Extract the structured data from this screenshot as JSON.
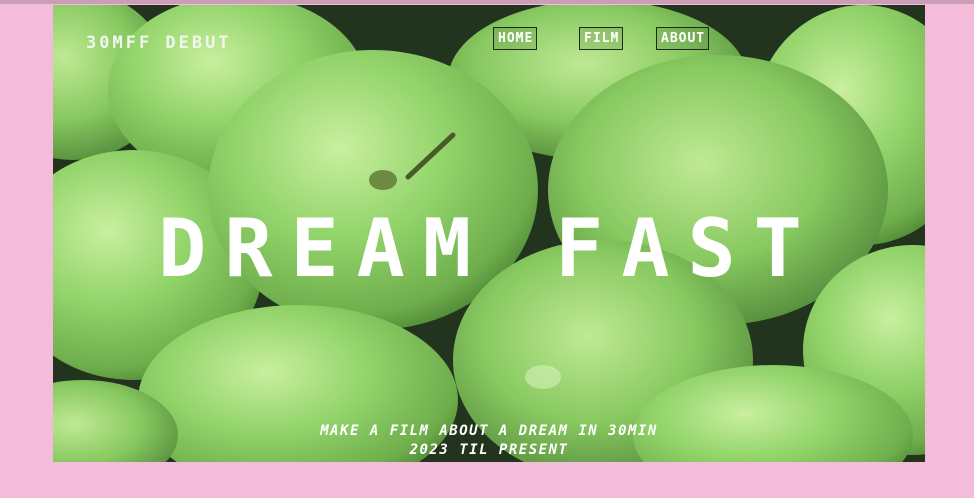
{
  "brand": {
    "name": "30MFF DEBUT"
  },
  "nav": {
    "items": [
      {
        "label": "HOME"
      },
      {
        "label": "FILM"
      },
      {
        "label": "ABOUT"
      }
    ]
  },
  "hero": {
    "title": "DREAM FAST",
    "tagline_line1": "MAKE A FILM ABOUT A DREAM IN 30MIN",
    "tagline_line2": "2023 TIL PRESENT"
  },
  "colors": {
    "page_background": "#f4bbdb",
    "apple_green": "#8fd26a",
    "text": "#ffffff"
  }
}
